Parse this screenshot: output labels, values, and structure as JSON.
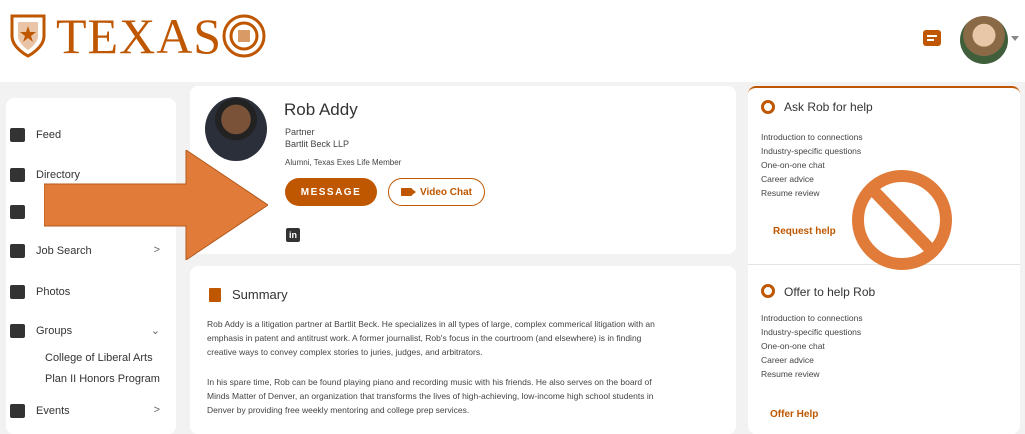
{
  "header": {
    "brand": "TEXAS",
    "accent_color": "#bf5700",
    "icons": [
      "shield-icon",
      "seal-icon",
      "message-icon",
      "user-avatar",
      "chevron-down-icon"
    ]
  },
  "sidebar": {
    "items": [
      {
        "label": "Feed",
        "icon": "feed-icon"
      },
      {
        "label": "Directory",
        "icon": "directory-icon"
      },
      {
        "label": "",
        "icon": "mentoring-icon"
      },
      {
        "label": "Job Search",
        "icon": "briefcase-icon",
        "caret": ">"
      },
      {
        "label": "Photos",
        "icon": "photo-icon"
      },
      {
        "label": "Groups",
        "icon": "groups-icon",
        "caret": "⌄"
      },
      {
        "label": "Events",
        "icon": "calendar-icon",
        "caret": ">"
      }
    ],
    "groups": [
      "College of Liberal Arts",
      "Plan II Honors Program"
    ]
  },
  "profile": {
    "name": "Rob Addy",
    "title": "Partner",
    "company": "Bartlit Beck LLP",
    "affiliation": "Alumni, Texas Exes Life Member",
    "message_label": "MESSAGE",
    "video_label": "Video Chat",
    "linkedin": "in"
  },
  "summary": {
    "title": "Summary",
    "paragraph1_line1": "Rob Addy is a litigation partner at Bartlit Beck. He specializes in all types of large, complex commerical litigation with an",
    "paragraph1_line2": "emphasis in patent and antitrust work. A former journalist, Rob's focus in the courtroom (and elsewhere) is in finding",
    "paragraph1_line3": "creative ways to convey complex stories to juries, judges, and arbitrators.",
    "paragraph2_line1": "In his spare time, Rob can be found playing piano and recording music with his friends. He also serves on the board of",
    "paragraph2_line2": "Minds Matter of Denver, an organization that transforms the lives of high-achieving, low-income high school students in",
    "paragraph2_line3": "Denver by providing free weekly mentoring and college prep services."
  },
  "ask_help": {
    "title": "Ask Rob for help",
    "items": [
      "Introduction to connections",
      "Industry-specific questions",
      "One-on-one chat",
      "Career advice",
      "Resume review"
    ],
    "link": "Request help"
  },
  "offer_help": {
    "title": "Offer to help Rob",
    "items": [
      "Introduction to connections",
      "Industry-specific questions",
      "One-on-one chat",
      "Career advice",
      "Resume review"
    ],
    "link": "Offer Help"
  },
  "overlay": {
    "arrow_color": "#e07b39",
    "ban_color": "#e07b39"
  }
}
